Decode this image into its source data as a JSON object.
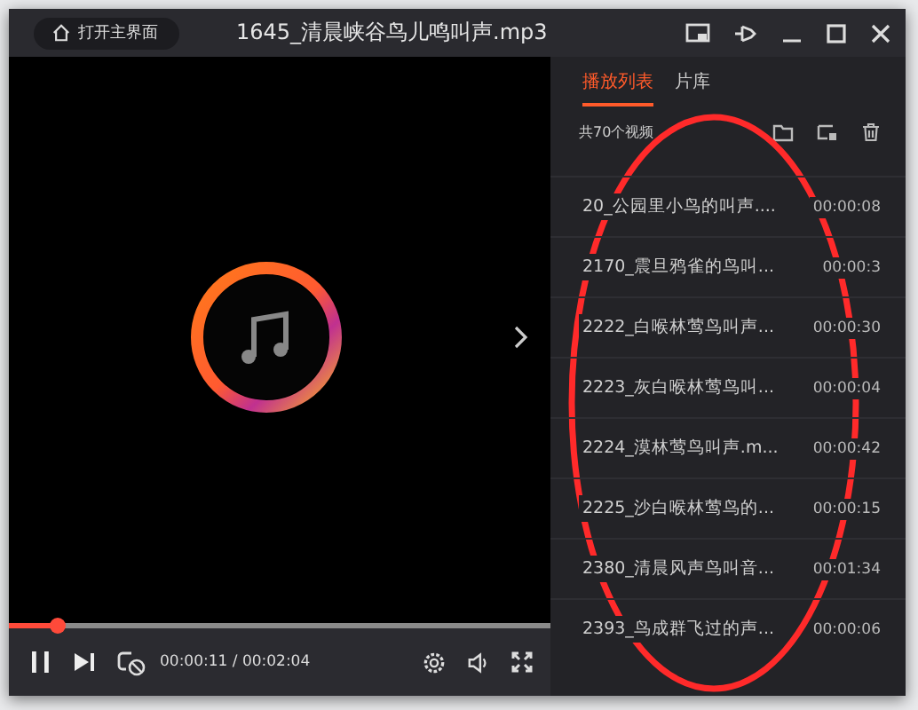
{
  "title_bar": {
    "home_button": "打开主界面",
    "title": "1645_清晨峡谷鸟儿鸣叫声.mp3"
  },
  "player": {
    "progress": {
      "level": 0.09
    },
    "time": "00:00:11 / 00:02:04",
    "playing": true
  },
  "sidebar": {
    "tabs": [
      {
        "label": "播放列表",
        "selected": true
      },
      {
        "label": "片库",
        "selected": false
      }
    ],
    "count": "共70个视频",
    "items": [
      {
        "title": "20_公园里小鸟的叫声....",
        "duration": "00:00:08"
      },
      {
        "title": "2170_震旦鸦雀的鸟叫...",
        "duration": "00:00:3"
      },
      {
        "title": "2222_白喉林莺鸟叫声...",
        "duration": "00:00:30"
      },
      {
        "title": "2223_灰白喉林莺鸟叫...",
        "duration": "00:00:04"
      },
      {
        "title": "2224_漠林莺鸟叫声.m...",
        "duration": "00:00:42"
      },
      {
        "title": "2225_沙白喉林莺鸟的...",
        "duration": "00:00:15"
      },
      {
        "title": "2380_清晨风声鸟叫音...",
        "duration": "00:01:34"
      },
      {
        "title": "2393_鸟成群飞过的声...",
        "duration": "00:00:06"
      }
    ]
  }
}
